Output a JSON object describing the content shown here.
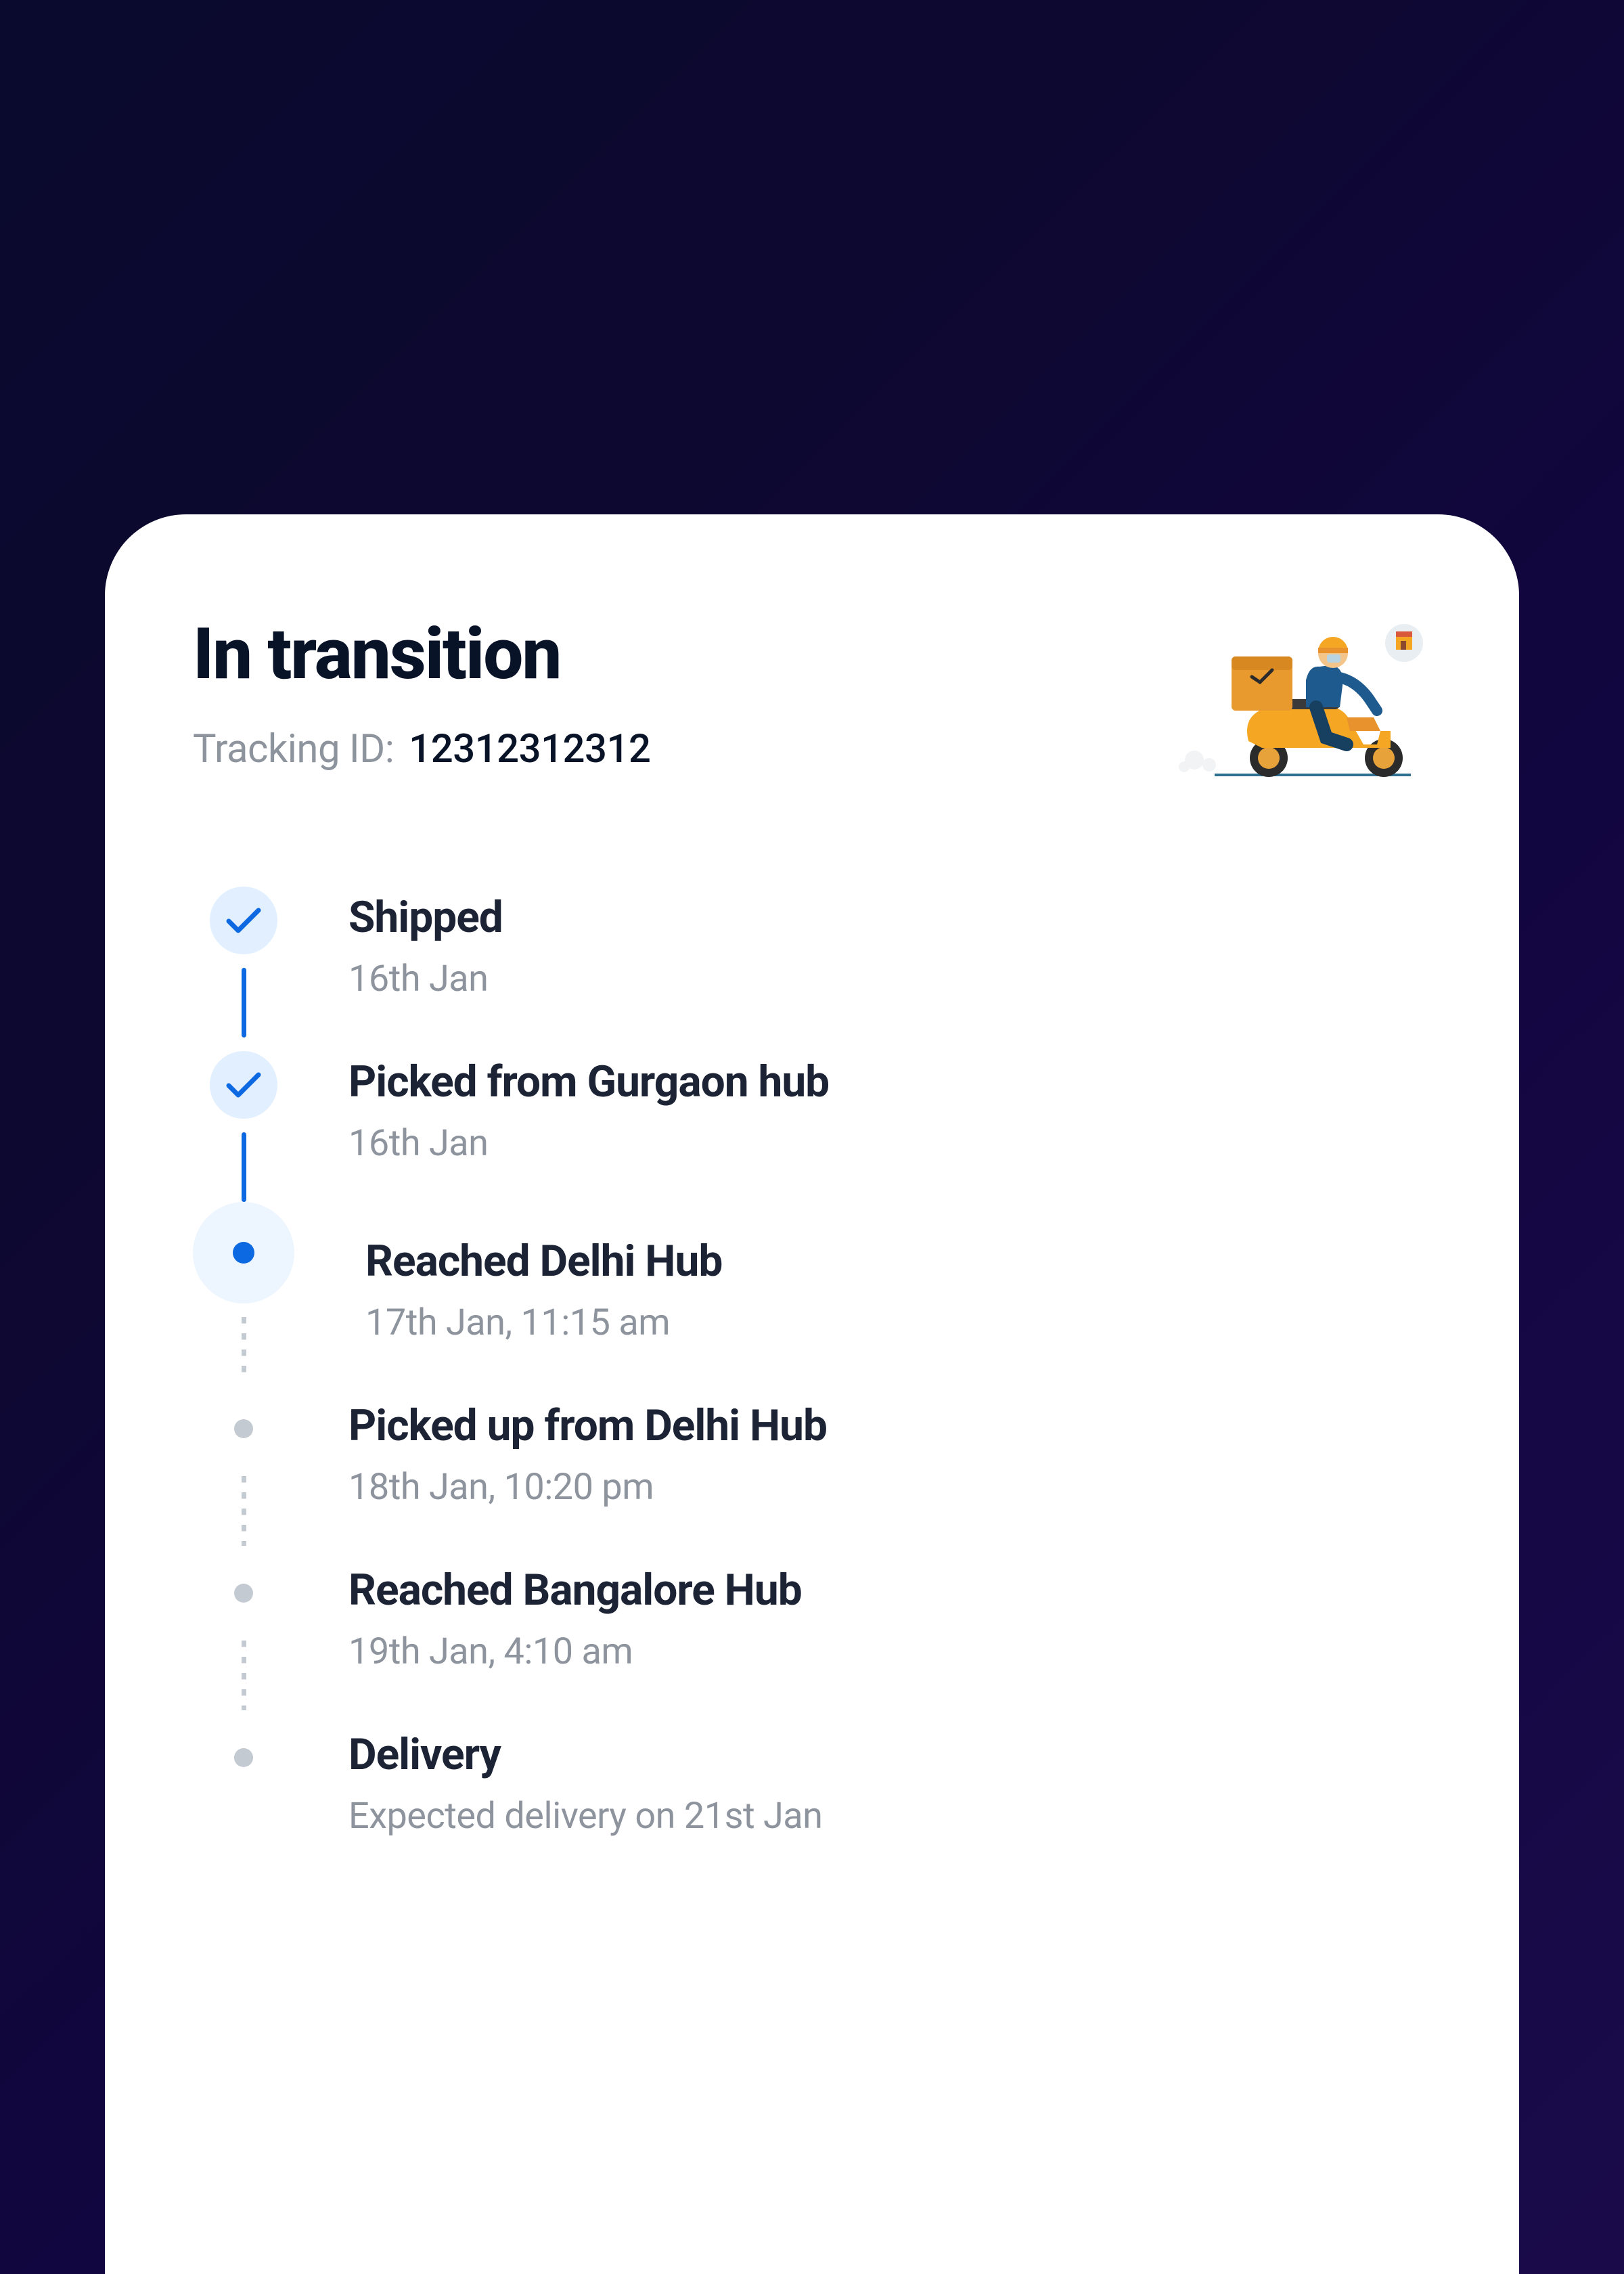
{
  "header": {
    "title": "In transition",
    "tracking_label": "Tracking ID:",
    "tracking_id": "12312312312"
  },
  "timeline": {
    "items": [
      {
        "title": "Shipped",
        "subtitle": "16th Jan",
        "state": "completed"
      },
      {
        "title": "Picked from Gurgaon hub",
        "subtitle": "16th Jan",
        "state": "completed"
      },
      {
        "title": "Reached Delhi Hub",
        "subtitle": "17th Jan, 11:15 am",
        "state": "current"
      },
      {
        "title": "Picked up from Delhi Hub",
        "subtitle": "18th Jan, 10:20 pm",
        "state": "pending"
      },
      {
        "title": "Reached Bangalore Hub",
        "subtitle": "19th Jan, 4:10 am",
        "state": "pending"
      },
      {
        "title": "Delivery",
        "subtitle": "Expected delivery on 21st Jan",
        "state": "pending"
      }
    ]
  },
  "illustration": {
    "name": "delivery-scooter-illustration"
  }
}
